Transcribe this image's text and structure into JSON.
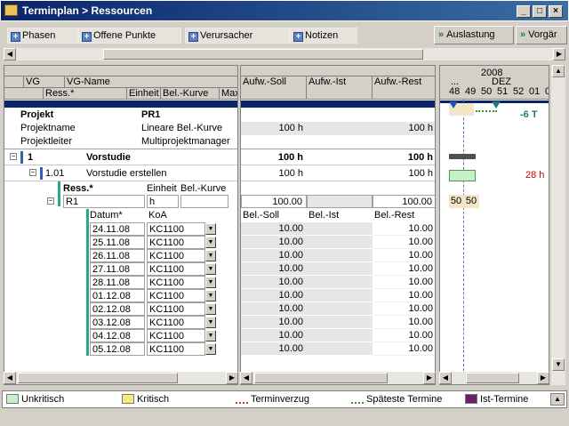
{
  "window": {
    "title": "Terminplan > Ressourcen"
  },
  "toolbar": {
    "tabs": [
      "Phasen",
      "Offene Punkte",
      "Verursacher",
      "Notizen"
    ],
    "right": [
      "Auslastung",
      "Vorgär"
    ]
  },
  "left": {
    "headers": {
      "vg": "VG",
      "vg_name": "VG-Name",
      "ress": "Ress.*",
      "einheit": "Einheit",
      "bel_kurve": "Bel.-Kurve",
      "max": "Max"
    },
    "project": {
      "projekt_label": "Projekt",
      "projekt_value": "PR1",
      "name_label": "Projektname",
      "name_value": "Lineare Bel.-Kurve",
      "leiter_label": "Projektleiter",
      "leiter_value": "Multiprojektmanager"
    },
    "rows": {
      "r1_id": "1",
      "r1_name": "Vorstudie",
      "r2_id": "1.01",
      "r2_name": "Vorstudie erstellen"
    },
    "ress_header": {
      "ress": "Ress.*",
      "einheit": "Einheit",
      "bel": "Bel.-Kurve"
    },
    "ress_row": {
      "name": "R1",
      "einheit": "h"
    },
    "sub_header": {
      "datum": "Datum*",
      "koa": "KoA"
    },
    "dates": [
      "24.11.08",
      "25.11.08",
      "26.11.08",
      "27.11.08",
      "28.11.08",
      "01.12.08",
      "02.12.08",
      "03.12.08",
      "04.12.08",
      "05.12.08"
    ],
    "koa": [
      "KC1100",
      "KC1100",
      "KC1100",
      "KC1100",
      "KC1100",
      "KC1100",
      "KC1100",
      "KC1100",
      "KC1100",
      "KC1100"
    ]
  },
  "mid": {
    "headers": {
      "soll": "Aufw.-Soll",
      "ist": "Aufw.-Ist",
      "rest": "Aufw.-Rest"
    },
    "proj_soll": "100 h",
    "proj_rest": "100 h",
    "r1_soll": "100 h",
    "r1_rest": "100 h",
    "r2_soll": "100 h",
    "r2_rest": "100 h",
    "ress_soll": "100.00",
    "ress_rest": "100.00",
    "sub_headers": {
      "soll": "Bel.-Soll",
      "ist": "Bel.-Ist",
      "rest": "Bel.-Rest"
    },
    "bel_soll": [
      "10.00",
      "10.00",
      "10.00",
      "10.00",
      "10.00",
      "10.00",
      "10.00",
      "10.00",
      "10.00",
      "10.00"
    ],
    "bel_rest": [
      "10.00",
      "10.00",
      "10.00",
      "10.00",
      "10.00",
      "10.00",
      "10.00",
      "10.00",
      "10.00",
      "10.00"
    ]
  },
  "gantt": {
    "year": "2008",
    "dots": "...",
    "month": "DEZ",
    "weeks": [
      "48",
      "49",
      "50",
      "51",
      "52",
      "01",
      "0"
    ],
    "proj_label": "-6 T",
    "task_label": "28 h",
    "ress_vals": [
      "50",
      "50"
    ]
  },
  "legend": {
    "items": [
      "Unkritisch",
      "Kritisch",
      "Terminverzug",
      "Späteste Termine",
      "Ist-Termine"
    ],
    "colors": {
      "unkritisch": "#c8f0c8",
      "kritisch": "#f4ec7a",
      "terminverzug": "#d03030",
      "spaeteste": "#2f9a2f",
      "ist": "#6a1f6a"
    }
  }
}
